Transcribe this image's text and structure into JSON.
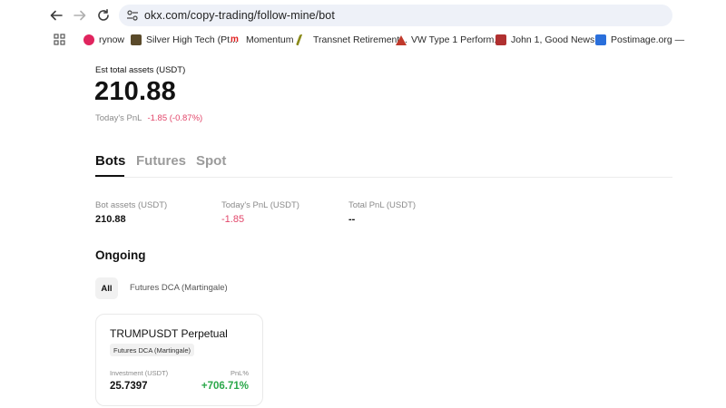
{
  "browser": {
    "url": "okx.com/copy-trading/follow-mine/bot",
    "bookmarks": [
      {
        "label": "rynow",
        "icon": "rynow-favicon",
        "color": "#e0245e"
      },
      {
        "label": "Silver High Tech (Pt...",
        "icon": "silver-favicon",
        "color": "#5a4a2a"
      },
      {
        "label": "Momentum",
        "icon": "momentum-favicon",
        "color": "#e02020"
      },
      {
        "label": "Transnet Retirement...",
        "icon": "transnet-favicon",
        "color": "#8a8a1a"
      },
      {
        "label": "VW Type 1 Perform...",
        "icon": "vw-favicon",
        "color": "#c0392b"
      },
      {
        "label": "John 1, Good News...",
        "icon": "bible-favicon",
        "color": "#b03030"
      },
      {
        "label": "Postimage.org —",
        "icon": "postimage-favicon",
        "color": "#2a6fdb"
      }
    ]
  },
  "summary": {
    "title": "Est total assets (USDT)",
    "value": "210.88",
    "pnl_label": "Today's PnL",
    "pnl_value": "-1.85 (-0.87%)"
  },
  "tabs": [
    {
      "label": "Bots",
      "active": true
    },
    {
      "label": "Futures",
      "active": false
    },
    {
      "label": "Spot",
      "active": false
    }
  ],
  "stats": [
    {
      "label": "Bot assets (USDT)",
      "value": "210.88"
    },
    {
      "label": "Today's PnL (USDT)",
      "value": "-1.85"
    },
    {
      "label": "Total PnL (USDT)",
      "value": "--"
    }
  ],
  "ongoing": {
    "title": "Ongoing",
    "filters": [
      "All",
      "Futures DCA (Martingale)"
    ]
  },
  "card": {
    "title": "TRUMPUSDT Perpetual",
    "tag": "Futures DCA (Martingale)",
    "investment_label": "Investment (USDT)",
    "investment_value": "25.7397",
    "pnl_label": "PnL%",
    "pnl_value": "+706.71%"
  },
  "colors": {
    "negative": "#e2466a",
    "positive": "#2ba84a"
  }
}
